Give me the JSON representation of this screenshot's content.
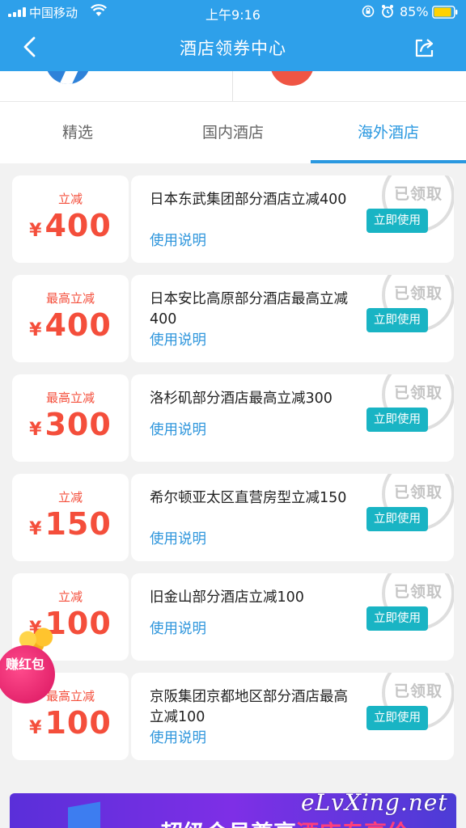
{
  "status_bar": {
    "carrier": "中国移动",
    "time": "上午9:16",
    "battery": "85%"
  },
  "nav": {
    "title": "酒店领券中心"
  },
  "tabs": [
    {
      "label": "精选",
      "active": false
    },
    {
      "label": "国内酒店",
      "active": false
    },
    {
      "label": "海外酒店",
      "active": true
    }
  ],
  "coupons": [
    {
      "label": "立减",
      "currency": "¥",
      "amount": "400",
      "title": "日本东武集团部分酒店立减400",
      "desc": "使用说明",
      "button": "立即使用",
      "stamp": "已领取"
    },
    {
      "label": "最高立减",
      "currency": "¥",
      "amount": "400",
      "title": "日本安比高原部分酒店最高立减400",
      "desc": "使用说明",
      "button": "立即使用",
      "stamp": "已领取"
    },
    {
      "label": "最高立减",
      "currency": "¥",
      "amount": "300",
      "title": "洛杉矶部分酒店最高立减300",
      "desc": "使用说明",
      "button": "立即使用",
      "stamp": "已领取"
    },
    {
      "label": "立减",
      "currency": "¥",
      "amount": "150",
      "title": "希尔顿亚太区直营房型立减150",
      "desc": "使用说明",
      "button": "立即使用",
      "stamp": "已领取"
    },
    {
      "label": "立减",
      "currency": "¥",
      "amount": "100",
      "title": "旧金山部分酒店立减100",
      "desc": "使用说明",
      "button": "立即使用",
      "stamp": "已领取"
    },
    {
      "label": "最高立减",
      "currency": "¥",
      "amount": "100",
      "title": "京阪集团京都地区部分酒店最高立减100",
      "desc": "使用说明",
      "button": "立即使用",
      "stamp": "已领取"
    }
  ],
  "floating_badge": {
    "text": "赚红包"
  },
  "promo": {
    "text_start": "超级会员尊享",
    "text_highlight": "酒店专享价"
  },
  "watermark": "eLvXing.net",
  "colors": {
    "primary": "#2ea0ea",
    "accent_red": "#f44e3b",
    "button_teal": "#19b4c4",
    "link_blue": "#2f96dc"
  }
}
